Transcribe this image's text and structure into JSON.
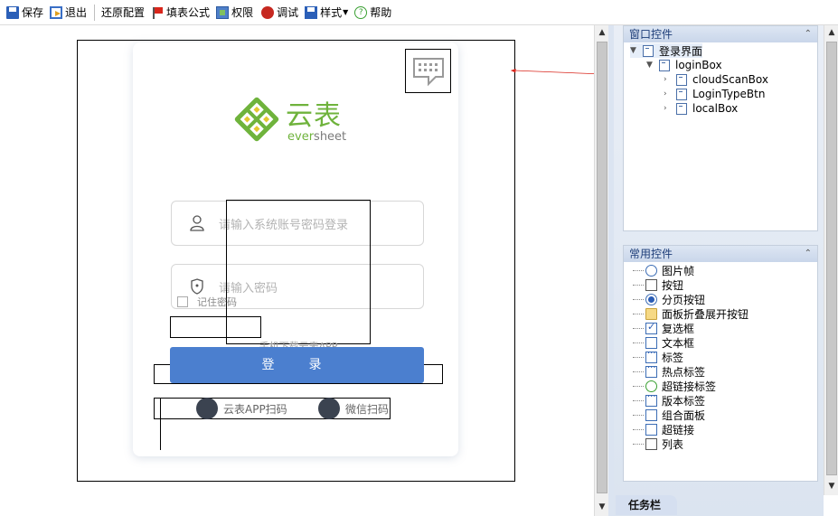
{
  "toolbar": {
    "items": [
      {
        "label": "保存",
        "icon": "save-icon"
      },
      {
        "label": "退出",
        "icon": "exit-icon"
      },
      {
        "label": "还原配置",
        "icon": ""
      },
      {
        "label": "填表公式",
        "icon": "flag-icon"
      },
      {
        "label": "权限",
        "icon": "permission-icon"
      },
      {
        "label": "调试",
        "icon": "bug-icon"
      },
      {
        "label": "样式",
        "icon": "style-icon"
      },
      {
        "label": "帮助",
        "icon": "help-icon"
      }
    ]
  },
  "canvas": {
    "logo_cn": "云表",
    "logo_en_a": "ever",
    "logo_en_b": "sheet",
    "username_placeholder": "请输入系统账号密码登录",
    "password_placeholder": "请输入密码",
    "remember_label": "记住密码",
    "download_hint": "手机下载云表APP",
    "login_button": "登　录",
    "scan_app": "云表APP扫码",
    "scan_wechat": "微信扫码"
  },
  "window_controls": {
    "title": "窗口控件",
    "tree": [
      {
        "label": "登录界面",
        "level": 0,
        "expanded": true
      },
      {
        "label": "loginBox",
        "level": 1,
        "expanded": true
      },
      {
        "label": "cloudScanBox",
        "level": 2,
        "expanded": false
      },
      {
        "label": "LoginTypeBtn",
        "level": 2,
        "expanded": false
      },
      {
        "label": "localBox",
        "level": 2,
        "expanded": false
      }
    ]
  },
  "common_controls": {
    "title": "常用控件",
    "items": [
      {
        "label": "图片帧",
        "icon": "image-frame-icon"
      },
      {
        "label": "按钮",
        "icon": "cursor-icon"
      },
      {
        "label": "分页按钮",
        "icon": "radio-icon"
      },
      {
        "label": "面板折叠展开按钮",
        "icon": "folder-icon"
      },
      {
        "label": "复选框",
        "icon": "checkbox-icon"
      },
      {
        "label": "文本框",
        "icon": "textbox-icon"
      },
      {
        "label": "标签",
        "icon": "label-icon"
      },
      {
        "label": "热点标签",
        "icon": "hotspot-label-icon"
      },
      {
        "label": "超链接标签",
        "icon": "hyperlink-label-icon"
      },
      {
        "label": "版本标签",
        "icon": "version-label-icon"
      },
      {
        "label": "组合面板",
        "icon": "panel-icon"
      },
      {
        "label": "超链接",
        "icon": "hyperlink-icon"
      },
      {
        "label": "列表",
        "icon": "list-icon"
      }
    ]
  },
  "taskbar": {
    "label": "任务栏"
  },
  "colors": {
    "brand_green": "#6fb33c",
    "login_blue": "#4b7fcf",
    "arrow_red": "#d9261c"
  }
}
